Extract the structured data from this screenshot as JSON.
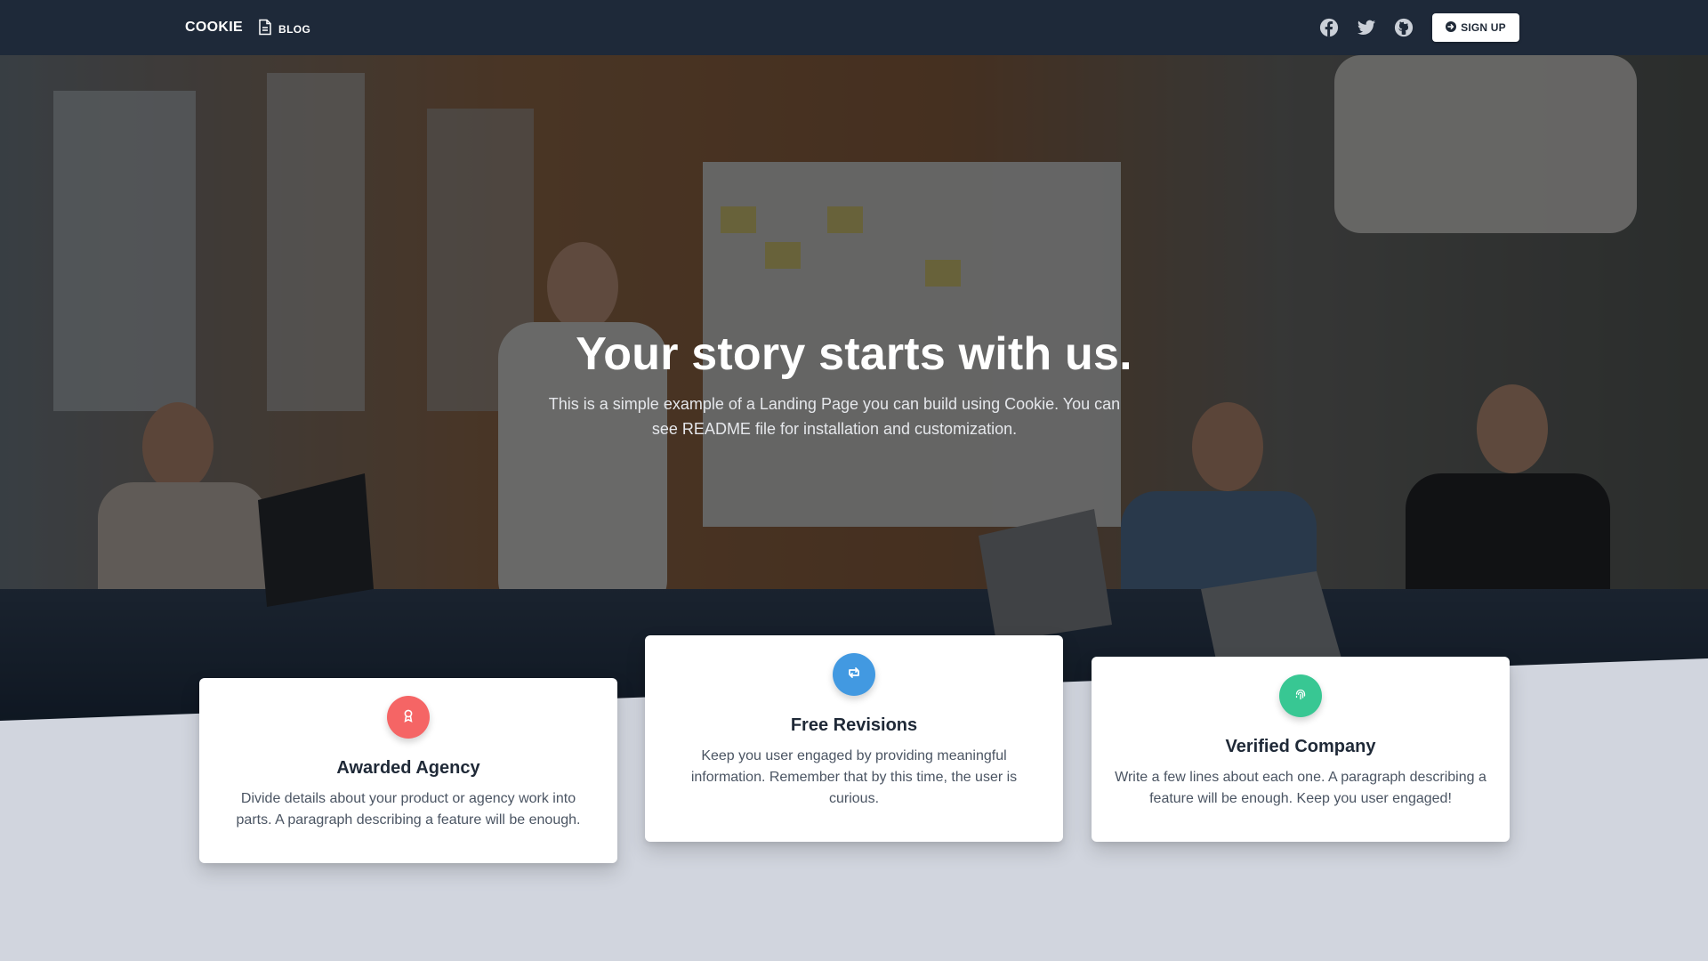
{
  "navbar": {
    "brand": "COOKIE",
    "blog_label": "BLOG",
    "social_icons": [
      "facebook-icon",
      "twitter-icon",
      "github-icon"
    ],
    "signup_label": "SIGN UP"
  },
  "hero": {
    "title": "Your story starts with us.",
    "subtitle": "This is a simple example of a Landing Page you can build using Cookie. You can see README file for installation and customization."
  },
  "features": [
    {
      "icon": "award-icon",
      "color": "#f56565",
      "title": "Awarded Agency",
      "text": "Divide details about your product or agency work into parts. A paragraph describing a feature will be enough."
    },
    {
      "icon": "retweet-icon",
      "color": "#4299e1",
      "title": "Free Revisions",
      "text": "Keep you user engaged by providing meaningful information. Remember that by this time, the user is curious."
    },
    {
      "icon": "fingerprint-icon",
      "color": "#38c793",
      "title": "Verified Company",
      "text": "Write a few lines about each one. A paragraph describing a feature will be enough. Keep you user engaged!"
    }
  ],
  "colors": {
    "navbar_bg": "#1e2939",
    "page_bg": "#d1d5de",
    "text_dark": "#1f2937"
  }
}
